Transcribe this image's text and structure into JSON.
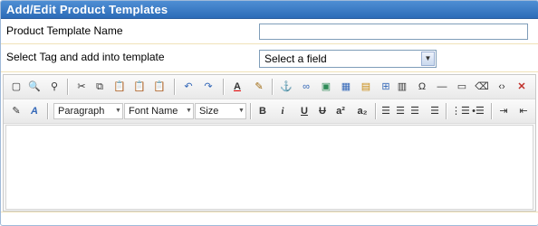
{
  "panel": {
    "title": "Add/Edit Product Templates"
  },
  "form": {
    "template_name_label": "Product Template Name",
    "template_name_value": "",
    "tag_label": "Select Tag and add into template",
    "tag_select_value": "Select a field"
  },
  "toolbar": {
    "format_dropdown": "Paragraph",
    "font_dropdown": "Font Name",
    "size_dropdown": "Size",
    "bold_glyph": "B",
    "italic_glyph": "i",
    "underline_glyph": "U",
    "strike_glyph": "U",
    "superscript_glyph": "a²",
    "subscript_glyph": "a₂",
    "text_color_glyph": "A",
    "icons_row1": [
      "full-screen-icon",
      "preview-icon",
      "find-icon",
      "cut-icon",
      "copy-icon",
      "paste-icon",
      "paste-text-icon",
      "paste-word-icon",
      "undo-icon",
      "redo-icon",
      "text-color-icon",
      "background-color-icon",
      "anchor-icon",
      "link-icon",
      "image-icon",
      "table-icon",
      "insert-form-icon",
      "toggle-borders-icon",
      "template-icon",
      "special-char-icon",
      "horizontal-rule-icon",
      "page-break-icon",
      "clean-icon",
      "source-code-icon",
      "close-icon"
    ],
    "icons_row2": [
      "edit-style-icon",
      "font-style-icon",
      "bold-icon",
      "italic-icon",
      "underline-icon",
      "strikethrough-icon",
      "superscript-icon",
      "subscript-icon",
      "align-left-icon",
      "align-center-icon",
      "align-right-icon",
      "justify-icon",
      "ordered-list-icon",
      "unordered-list-icon",
      "indent-icon",
      "outdent-icon"
    ]
  },
  "editor": {
    "content": ""
  }
}
